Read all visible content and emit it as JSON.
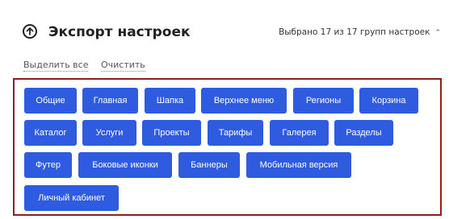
{
  "header": {
    "title": "Экспорт настроек",
    "selection_summary": "Выбрано 17 из 17 групп настроек",
    "chevron_glyph": "⌃"
  },
  "actions": {
    "select_all": "Выделить все",
    "clear": "Очистить"
  },
  "groups": [
    "Общие",
    "Главная",
    "Шапка",
    "Верхнее меню",
    "Регионы",
    "Корзина",
    "Каталог",
    "Услуги",
    "Проекты",
    "Тарифы",
    "Галерея",
    "Разделы",
    "Футер",
    "Боковые иконки",
    "Баннеры",
    "Мобильная версия",
    "Личный кабинет"
  ],
  "colors": {
    "chip_background": "#2f5be0",
    "box_border": "#8f1f1f"
  }
}
